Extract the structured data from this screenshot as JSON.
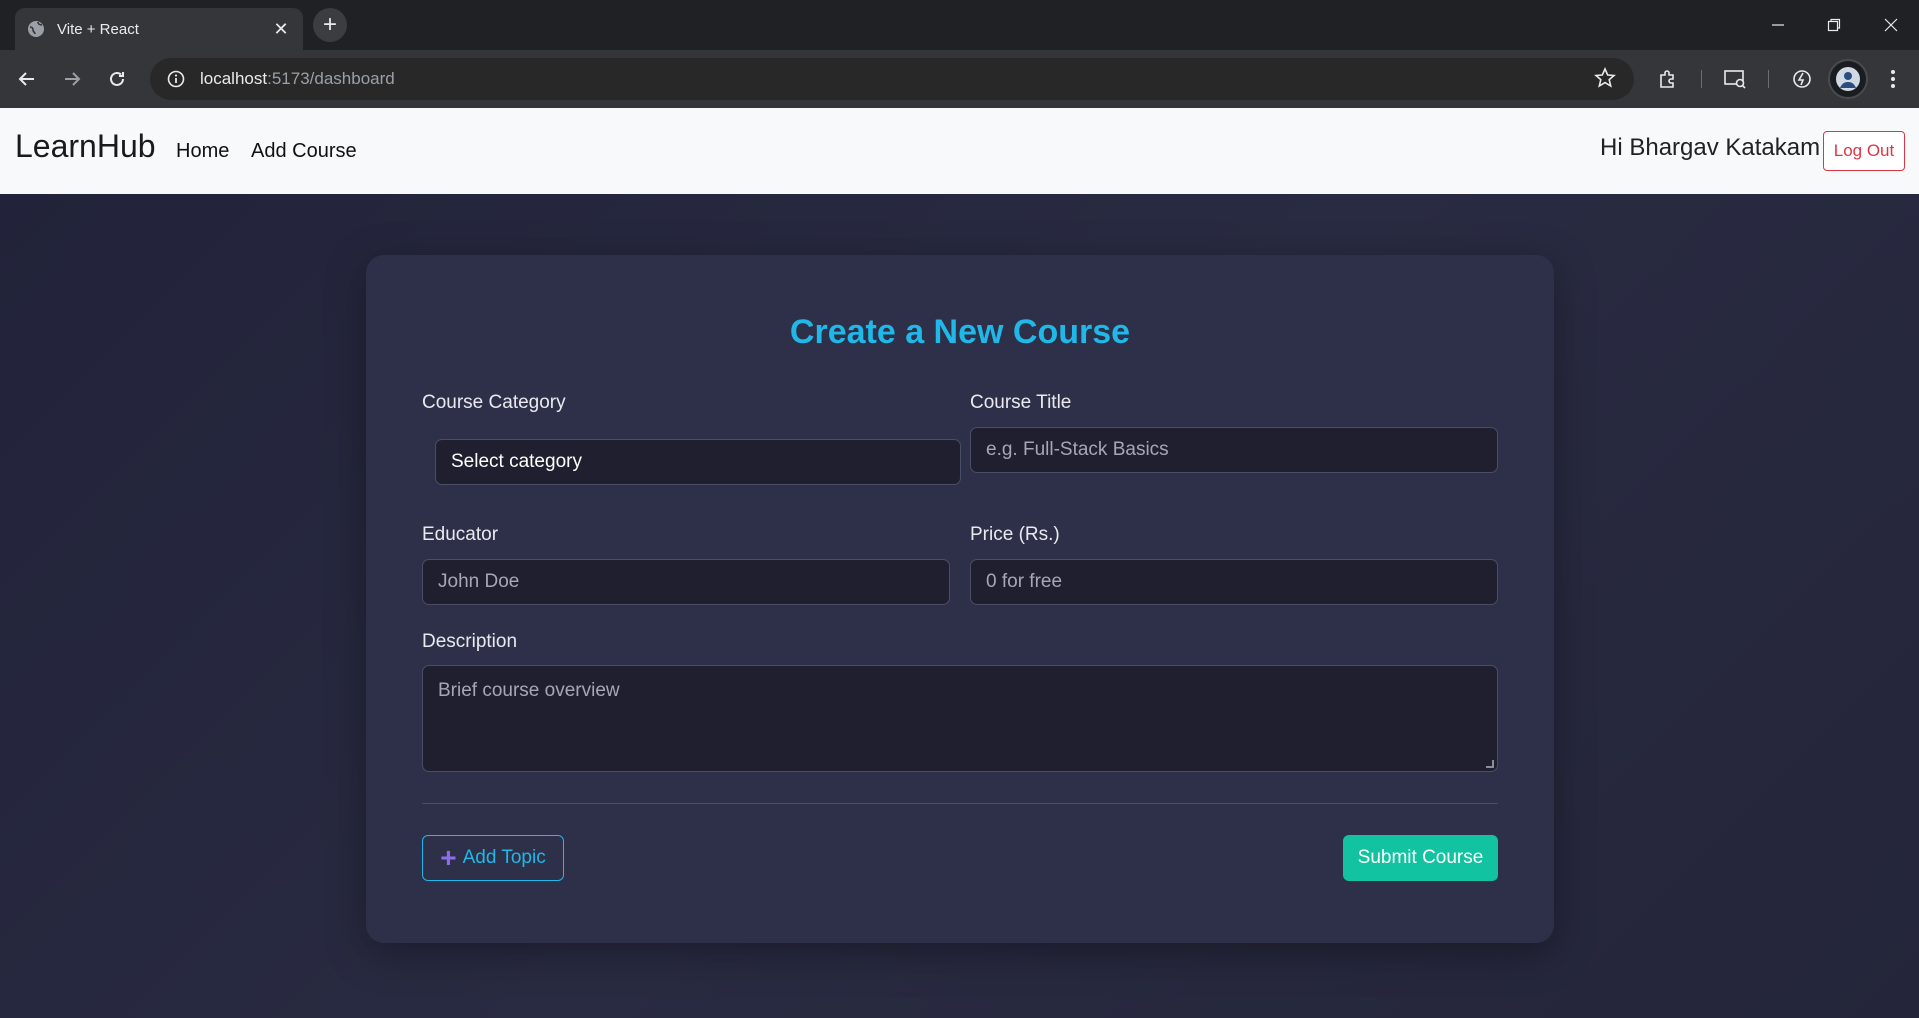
{
  "browser": {
    "tab_title": "Vite + React",
    "url_host": "localhost",
    "url_path": ":5173/dashboard",
    "new_tab_symbol": "+",
    "close_symbol": "✕"
  },
  "navbar": {
    "brand": "LearnHub",
    "links": [
      "Home",
      "Add Course"
    ],
    "greeting": "Hi Bhargav Katakam",
    "logout_label": "Log Out"
  },
  "form": {
    "title": "Create a New Course",
    "category": {
      "label": "Course Category",
      "value": "Select category"
    },
    "course_title": {
      "label": "Course Title",
      "placeholder": "e.g. Full-Stack Basics"
    },
    "educator": {
      "label": "Educator",
      "placeholder": "John Doe"
    },
    "price": {
      "label": "Price (Rs.)",
      "placeholder": "0 for free"
    },
    "description": {
      "label": "Description",
      "placeholder": "Brief course overview"
    },
    "add_topic_label": "Add Topic",
    "submit_label": "Submit Course"
  },
  "colors": {
    "accent": "#1fb8e8",
    "submit": "#11c3a0",
    "logout": "#dc3545",
    "plus_icon": "#8d6cf0"
  },
  "icons": [
    "globe-icon",
    "close-icon",
    "plus-icon",
    "back-arrow-icon",
    "forward-arrow-icon",
    "reload-icon",
    "site-info-icon",
    "star-icon",
    "extensions-icon",
    "cast-icon",
    "performance-icon",
    "avatar-icon",
    "minimize-icon",
    "restore-icon",
    "window-close-icon",
    "menu-dots-icon"
  ]
}
